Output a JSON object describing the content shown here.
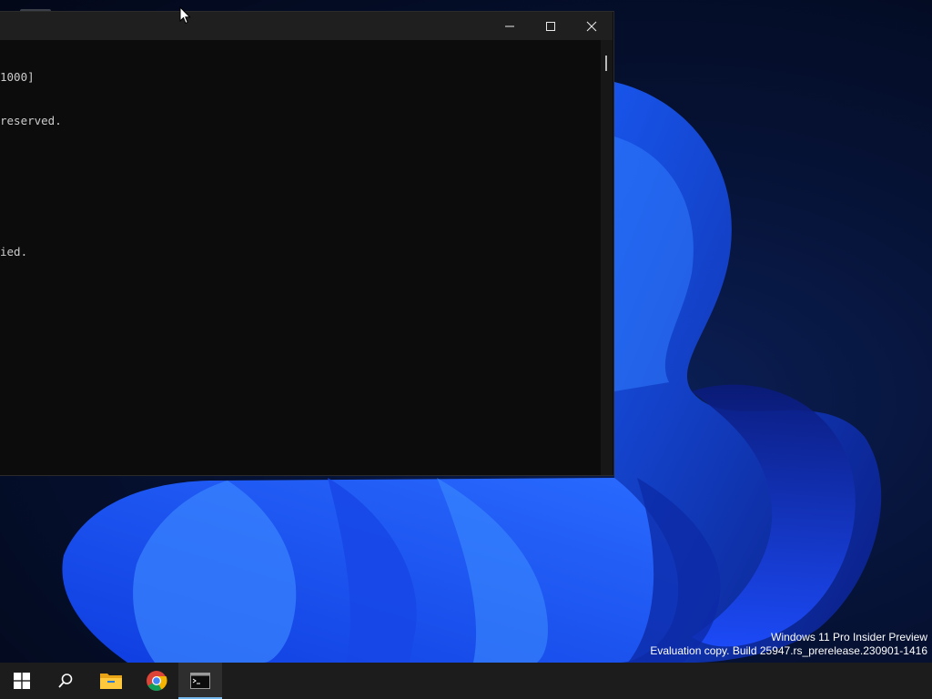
{
  "console": {
    "lines": [
      "1000]",
      "reserved.",
      "",
      "",
      "ied."
    ]
  },
  "window_controls": {
    "minimize": "minimize",
    "maximize": "maximize",
    "close": "close"
  },
  "watermark": {
    "line1": "Windows 11 Pro Insider Preview",
    "line2": "Evaluation copy. Build 25947.rs_prerelease.230901-1416"
  },
  "taskbar": {
    "items": [
      {
        "icon": "windows-start-icon"
      },
      {
        "icon": "search-icon"
      },
      {
        "icon": "file-explorer-icon"
      },
      {
        "icon": "chrome-icon"
      },
      {
        "icon": "command-prompt-icon",
        "active": true
      }
    ]
  },
  "colors": {
    "console_bg": "#0c0c0c",
    "console_text": "#cccccc",
    "titlebar": "#1f1f1f",
    "taskbar": "#1c1c1c",
    "accent": "#76b9ed"
  }
}
